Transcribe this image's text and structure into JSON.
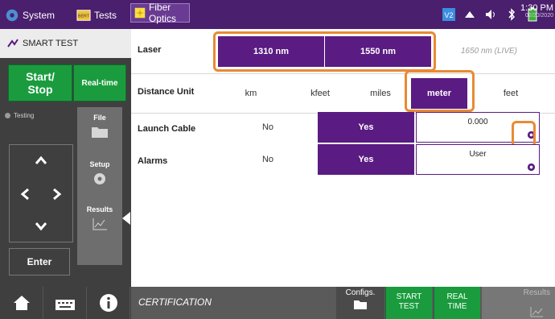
{
  "topbar": {
    "system_label": "System",
    "tests_label": "Tests",
    "fiber_label": "Fiber Optics",
    "clock_time": "1:30 PM",
    "clock_date": "02/20/2020",
    "status_icons": [
      "vnc-icon",
      "wifi-icon",
      "speaker-icon",
      "bluetooth-icon",
      "battery-icon"
    ]
  },
  "left": {
    "title": "SMART TEST",
    "start_stop_line1": "Start/",
    "start_stop_line2": "Stop",
    "realtime_label": "Real-time",
    "status_label": "Testing",
    "tabs": {
      "file": "File",
      "setup": "Setup",
      "results": "Results"
    },
    "enter_label": "Enter"
  },
  "settings": {
    "laser": {
      "label": "Laser",
      "options": [
        "1310 nm",
        "1550 nm",
        "1650 nm (LIVE)"
      ],
      "selected": [
        "1310 nm",
        "1550 nm"
      ]
    },
    "distance_unit": {
      "label": "Distance Unit",
      "options": [
        "km",
        "kfeet",
        "miles",
        "meter",
        "feet"
      ],
      "selected": "meter"
    },
    "launch_cable": {
      "label": "Launch Cable",
      "no": "No",
      "yes": "Yes",
      "value": "0.000"
    },
    "alarms": {
      "label": "Alarms",
      "no": "No",
      "yes": "Yes",
      "value": "User"
    }
  },
  "bottom": {
    "certification": "CERTIFICATION",
    "configs": "Configs.",
    "start_test_line1": "START",
    "start_test_line2": "TEST",
    "real_time_line1": "REAL",
    "real_time_line2": "TIME",
    "results": "Results"
  },
  "colors": {
    "accent_purple": "#5a1b82",
    "highlight_orange": "#e88a34",
    "green": "#1a9c3e",
    "topbar": "#4a1f6d"
  }
}
